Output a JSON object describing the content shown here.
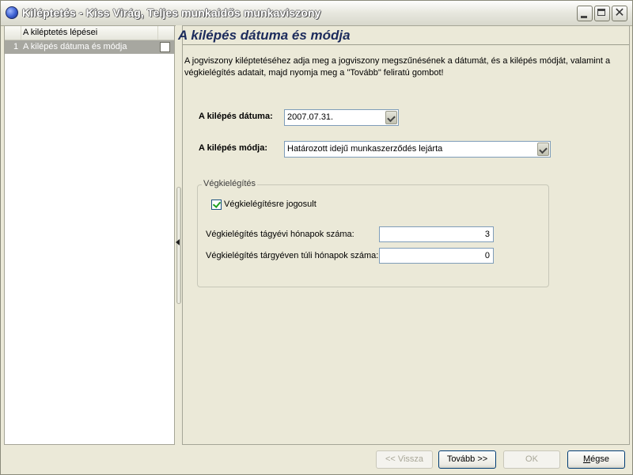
{
  "window": {
    "title": "Kiléptetés - Kiss Virág, Teljes munkaidős munkaviszony",
    "controls": {
      "minimize": "minimize-icon",
      "maximize": "maximize-icon",
      "close": "close-icon",
      "close_glyph": "✕"
    }
  },
  "steps_panel": {
    "header": "A kiléptetés lépései",
    "items": [
      {
        "number": "1",
        "label": "A kilépés dátuma és módja",
        "selected": true
      }
    ]
  },
  "page": {
    "title": "A kilépés dátuma és módja",
    "description": "A jogviszony kiléptetéséhez adja meg a jogviszony megszűnésének a dátumát, és a kilépés módját, valamint a végkielégítés adatait, majd nyomja meg a \"Tovább\" feliratú gombot!",
    "exit_date_label": "A kilépés dátuma:",
    "exit_date_value": "2007.07.31.",
    "exit_mode_label": "A kilépés módja:",
    "exit_mode_value": "Határozott idejű munkaszerződés lejárta"
  },
  "severance": {
    "group_title": "Végkielégítés",
    "eligible_label": "Végkielégítésre jogosult",
    "eligible_checked": true,
    "current_year_months_label": "Végkielégítés tágyévi hónapok száma:",
    "current_year_months_value": "3",
    "beyond_year_months_label": "Végkielégítés tárgyéven túli hónapok száma:",
    "beyond_year_months_value": "0"
  },
  "buttons": {
    "back": "<< Vissza",
    "next": "Tovább >>",
    "ok": "OK",
    "cancel_prefix": "",
    "cancel_u": "M",
    "cancel_rest": "égse"
  },
  "colors": {
    "title_text": "#1c2b5c",
    "selected_row": "#a7a7a0",
    "window_bg": "#ebe9d8",
    "checkbox_check": "#21a121"
  }
}
